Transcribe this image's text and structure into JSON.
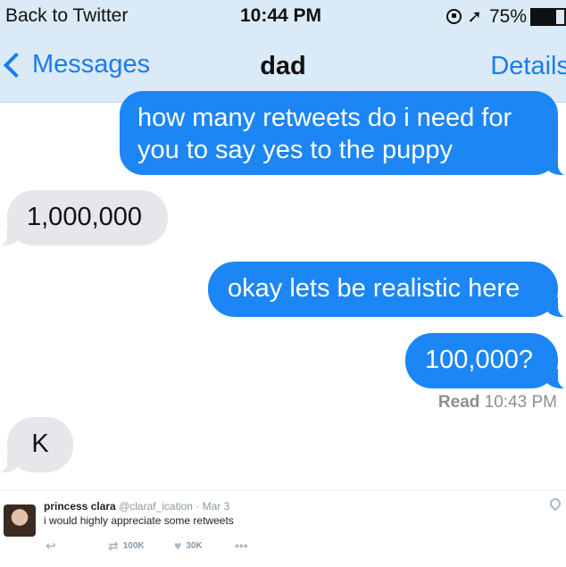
{
  "status_bar": {
    "back_app": "Back to Twitter",
    "time": "10:44 PM",
    "battery": "75%",
    "battery_level": 0.75
  },
  "nav": {
    "back_label": "Messages",
    "title": "dad",
    "details_label": "Details"
  },
  "messages": [
    {
      "direction": "sent",
      "text": "how many retweets do i need for you to say yes to the puppy"
    },
    {
      "direction": "received",
      "text": "1,000,000"
    },
    {
      "direction": "sent",
      "text": "okay lets be realistic here"
    },
    {
      "direction": "sent",
      "text": "100,000?"
    },
    {
      "direction": "received",
      "text": "K"
    }
  ],
  "read_receipt": {
    "label": "Read",
    "time": "10:43 PM"
  },
  "tweet": {
    "name": "princess clara",
    "handle": "@claraf_ication",
    "date": "Mar 3",
    "text": "i would highly appreciate some retweets",
    "retweets": "100K",
    "likes": "30K"
  },
  "colors": {
    "sent_bubble": "#1d86f5",
    "received_bubble": "#e6e6eb",
    "accent": "#1a7cf0",
    "bar_background": "#daeaf6"
  }
}
